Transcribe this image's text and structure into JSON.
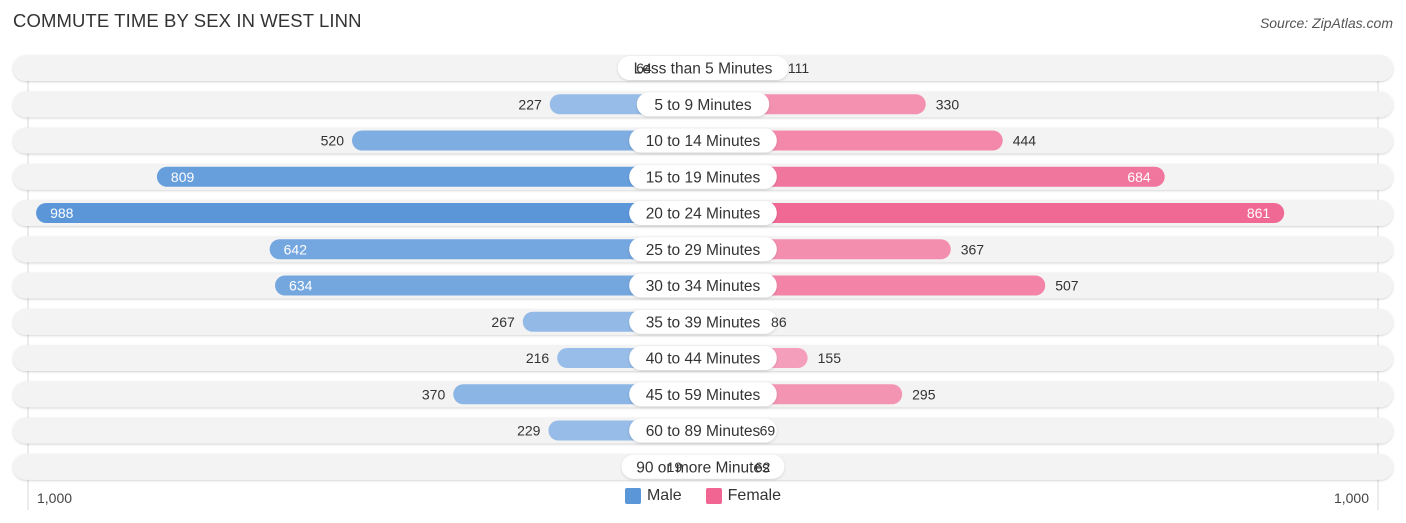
{
  "header": {
    "title": "COMMUTE TIME BY SEX IN WEST LINN",
    "source": "Source: ZipAtlas.com"
  },
  "colors": {
    "male_light": "#a9c8ec",
    "male_dark": "#5b96d9",
    "female_light": "#f6aac3",
    "female_dark": "#f06592",
    "track": "#f3f3f3"
  },
  "chart_data": {
    "type": "bar",
    "orientation": "horizontal-diverging",
    "title": "COMMUTE TIME BY SEX IN WEST LINN",
    "categories": [
      "Less than 5 Minutes",
      "5 to 9 Minutes",
      "10 to 14 Minutes",
      "15 to 19 Minutes",
      "20 to 24 Minutes",
      "25 to 29 Minutes",
      "30 to 34 Minutes",
      "35 to 39 Minutes",
      "40 to 44 Minutes",
      "45 to 59 Minutes",
      "60 to 89 Minutes",
      "90 or more Minutes"
    ],
    "series": [
      {
        "name": "Male",
        "side": "left",
        "values": [
          64,
          227,
          520,
          809,
          988,
          642,
          634,
          267,
          216,
          370,
          229,
          19
        ]
      },
      {
        "name": "Female",
        "side": "right",
        "values": [
          111,
          330,
          444,
          684,
          861,
          367,
          507,
          86,
          155,
          295,
          69,
          62
        ]
      }
    ],
    "xlim": [
      0,
      1000
    ],
    "axis_labels": {
      "left": "1,000",
      "right": "1,000"
    },
    "legend": {
      "position": "bottom-center",
      "entries": [
        "Male",
        "Female"
      ]
    },
    "xlabel": "",
    "ylabel": ""
  }
}
